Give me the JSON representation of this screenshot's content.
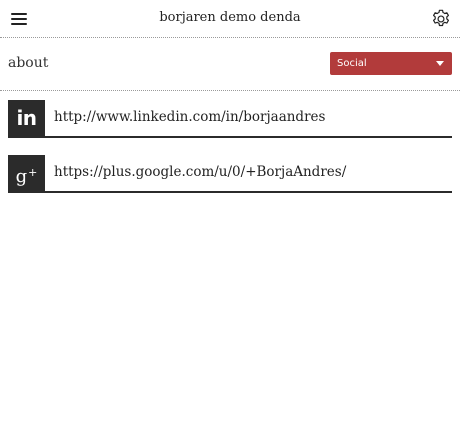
{
  "header": {
    "title": "borjaren demo denda",
    "menu_icon": "hamburger-menu-icon",
    "settings_icon": "gear-icon"
  },
  "about": {
    "label": "about",
    "select": {
      "selected": "Social",
      "color": "#b23b3b"
    }
  },
  "links": [
    {
      "network": "linkedin",
      "icon": "linkedin-icon",
      "icon_text": "in",
      "url": "http://www.linkedin.com/in/borjaandres"
    },
    {
      "network": "google-plus",
      "icon": "google-plus-icon",
      "icon_text": "g",
      "icon_sup": "+",
      "url": "https://plus.google.com/u/0/+BorjaAndres/"
    }
  ]
}
